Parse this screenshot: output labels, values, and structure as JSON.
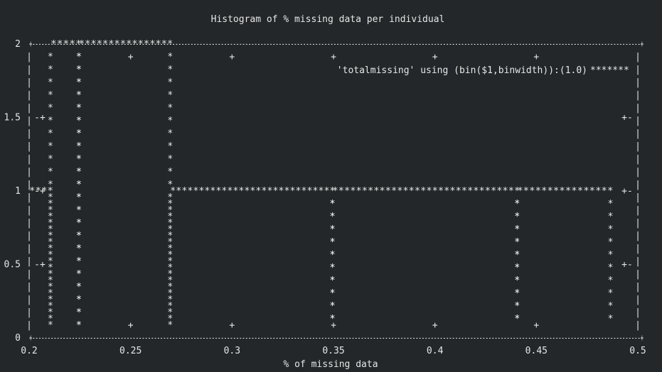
{
  "colors": {
    "background": "#232729",
    "foreground": "#e6e6e6"
  },
  "chart_data": {
    "type": "bar",
    "style": "ascii-terminal",
    "title": "Histogram of % missing data per individual",
    "xlabel": "% of missing data",
    "ylabel": "",
    "xlim": [
      0.2,
      0.5
    ],
    "ylim": [
      0,
      2
    ],
    "x_ticks": [
      "0.2",
      "0.25",
      "0.3",
      "0.35",
      "0.4",
      "0.45",
      "0.5"
    ],
    "y_ticks": [
      "0",
      "0.5",
      "1",
      "1.5",
      "2"
    ],
    "legend": {
      "position": "top-right",
      "label": "'totalmissing' using (bin($1,binwidth)):(1.0)",
      "marker": "*******"
    },
    "grid": false,
    "bars": [
      {
        "x0": 0.2,
        "x1": 0.2105,
        "value": 1
      },
      {
        "x0": 0.2105,
        "x1": 0.2245,
        "value": 2
      },
      {
        "x0": 0.2245,
        "x1": 0.2695,
        "value": 2
      },
      {
        "x0": 0.2695,
        "x1": 0.3495,
        "value": 1
      },
      {
        "x0": 0.3495,
        "x1": 0.4405,
        "value": 1
      },
      {
        "x0": 0.4405,
        "x1": 0.4865,
        "value": 1
      }
    ]
  }
}
